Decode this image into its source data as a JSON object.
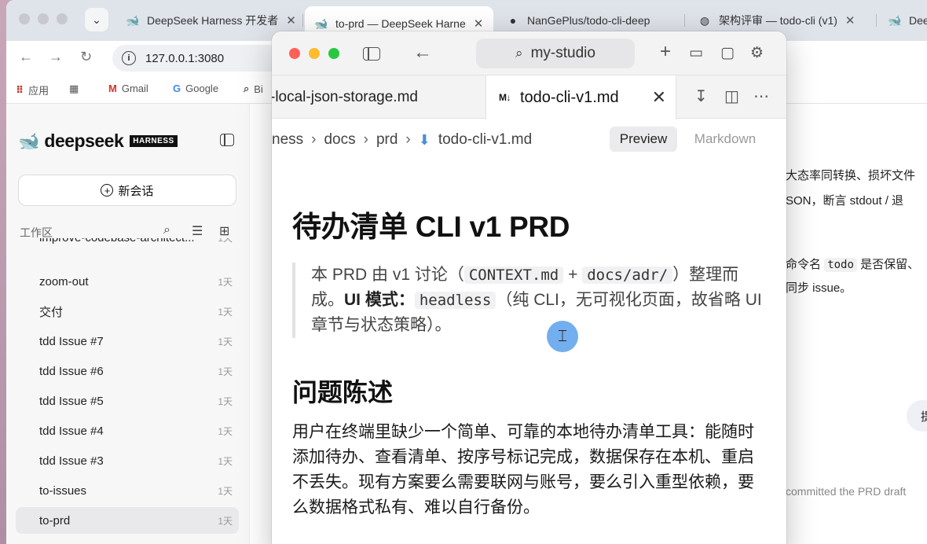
{
  "browser": {
    "tabs": [
      {
        "label": "DeepSeek Harness 开发者",
        "icon": "deepseek-whale-icon"
      },
      {
        "label": "to-prd — DeepSeek Harne",
        "icon": "deepseek-whale-icon",
        "active": true
      },
      {
        "label": "NanGePlus/todo-cli-deep",
        "icon": "github-icon"
      },
      {
        "label": "架构评审 — todo-cli (v1)",
        "icon": "globe-icon"
      },
      {
        "label": "Dee",
        "icon": "deepseek-whale-icon"
      }
    ],
    "url": "127.0.0.1:3080",
    "bookmarks": [
      {
        "label": "应用",
        "icon": "apps-grid-icon"
      },
      {
        "label": "",
        "icon": "tab-groups-icon"
      },
      {
        "label": "Gmail",
        "icon": "gmail-icon"
      },
      {
        "label": "Google",
        "icon": "google-icon"
      },
      {
        "label": "Bi",
        "icon": "search-icon"
      }
    ]
  },
  "sidebar": {
    "logo_text": "deepseek",
    "badge": "HARNESS",
    "new_chat": "新会话",
    "workspace_label": "工作区",
    "items": [
      {
        "label": "improve-codebase-architect...",
        "age": "1天"
      },
      {
        "label": "zoom-out",
        "age": "1天"
      },
      {
        "label": "交付",
        "age": "1天"
      },
      {
        "label": "tdd Issue #7",
        "age": "1天"
      },
      {
        "label": "tdd Issue #6",
        "age": "1天"
      },
      {
        "label": "tdd Issue #5",
        "age": "1天"
      },
      {
        "label": "tdd Issue #4",
        "age": "1天"
      },
      {
        "label": "tdd Issue #3",
        "age": "1天"
      },
      {
        "label": "to-issues",
        "age": "1天"
      },
      {
        "label": "to-prd",
        "age": "1天",
        "active": true
      }
    ]
  },
  "chat_peek": {
    "line1": "大态率同转换、损坏文件",
    "line2": "SON，断言 stdout / 退",
    "line3_pre": "命令名",
    "line3_code": "todo",
    "line3_post": "是否保留、",
    "line4": "同步 issue。",
    "bubble": "提",
    "footer": "committed the PRD draft"
  },
  "studio": {
    "search_label": "my-studio",
    "tab_prev": "-local-json-storage.md",
    "tab_active": "todo-cli-v1.md",
    "md_badge": "M↓",
    "breadcrumb": [
      "ness",
      "docs",
      "prd",
      "todo-cli-v1.md"
    ],
    "view_preview": "Preview",
    "view_markdown": "Markdown",
    "doc": {
      "title": "待办清单 CLI v1 PRD",
      "quote_1": "本 PRD 由 v1 讨论（",
      "quote_code_1": "CONTEXT.md",
      "quote_2": " + ",
      "quote_code_2": "docs/adr/",
      "quote_3": "）整理而成。",
      "quote_bold": "UI 模式：",
      "quote_code_3": "headless",
      "quote_4": "（纯 CLI，无可视化页面，故省略 UI 章节与状态策略）。",
      "h2": "问题陈述",
      "para": "用户在终端里缺少一个简单、可靠的本地待办清单工具：能随时添加待办、查看清单、按序号标记完成，数据保存在本机、重启不丢失。现有方案要么需要联网与账号，要么引入重型依赖，要么数据格式私有、难以自行备份。"
    }
  },
  "colors": {
    "close": "#ff5f57",
    "minimize": "#febc2e",
    "zoom": "#28c840",
    "cursor_highlight": "#5ba0eb",
    "md_file_icon": "#4a8fd8"
  }
}
